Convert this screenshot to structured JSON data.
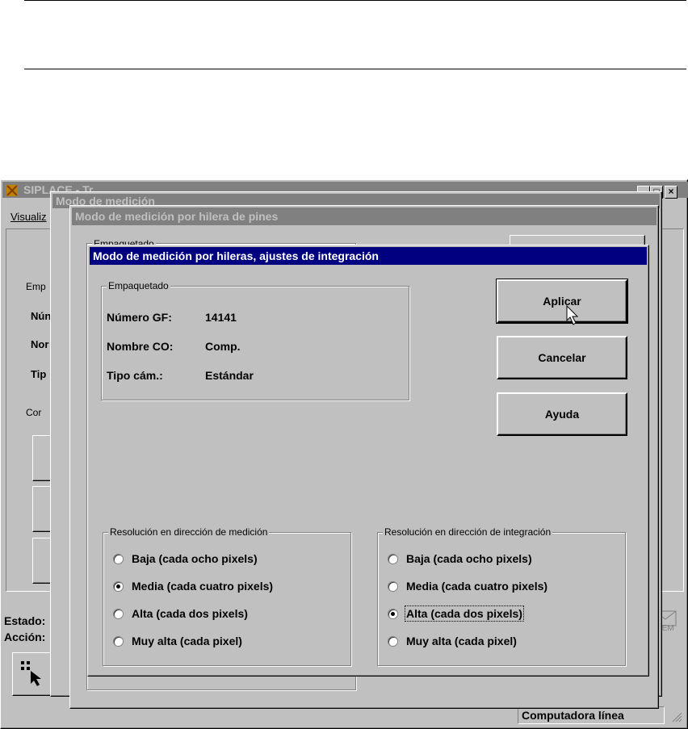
{
  "app": {
    "title": "SIPLACE - Tr...",
    "menu_visualize": "Visualiz",
    "status_label": "Estado:",
    "action_label": "Acción:",
    "status_bar_text": "Computadora línea",
    "tool_icon": "pointer-grid-icon",
    "sem_icon_text": "SEM",
    "left_fragments": [
      "Emp",
      "Nún",
      "Nor",
      "Tip",
      "Cor"
    ]
  },
  "window_back": {
    "title": "Modo de medición"
  },
  "window_mid": {
    "title": "Modo de medición por hilera de pines",
    "group_label": "Empaquetado"
  },
  "dialog": {
    "title": "Modo de medición por hileras, ajustes de integración",
    "package_group": {
      "legend": "Empaquetado",
      "rows": [
        {
          "label": "Número GF:",
          "value": "14141"
        },
        {
          "label": "Nombre CO:",
          "value": "Comp."
        },
        {
          "label": "Tipo cám.:",
          "value": "Estándar"
        }
      ]
    },
    "buttons": {
      "apply": "Aplicar",
      "cancel": "Cancelar",
      "help": "Ayuda"
    },
    "measure_group": {
      "legend": "Resolución en dirección de medición",
      "options": [
        {
          "label": "Baja (cada ocho pixels)",
          "checked": false
        },
        {
          "label": "Media (cada cuatro pixels)",
          "checked": true
        },
        {
          "label": "Alta (cada dos pixels)",
          "checked": false
        },
        {
          "label": "Muy alta (cada pixel)",
          "checked": false
        }
      ]
    },
    "integration_group": {
      "legend": "Resolución en dirección de integración",
      "options": [
        {
          "label": "Baja (cada ocho pixels)",
          "checked": false
        },
        {
          "label": "Media (cada cuatro pixels)",
          "checked": false
        },
        {
          "label": "Alta (cada dos pixels)",
          "checked": true
        },
        {
          "label": "Muy alta (cada pixel)",
          "checked": false
        }
      ]
    }
  }
}
